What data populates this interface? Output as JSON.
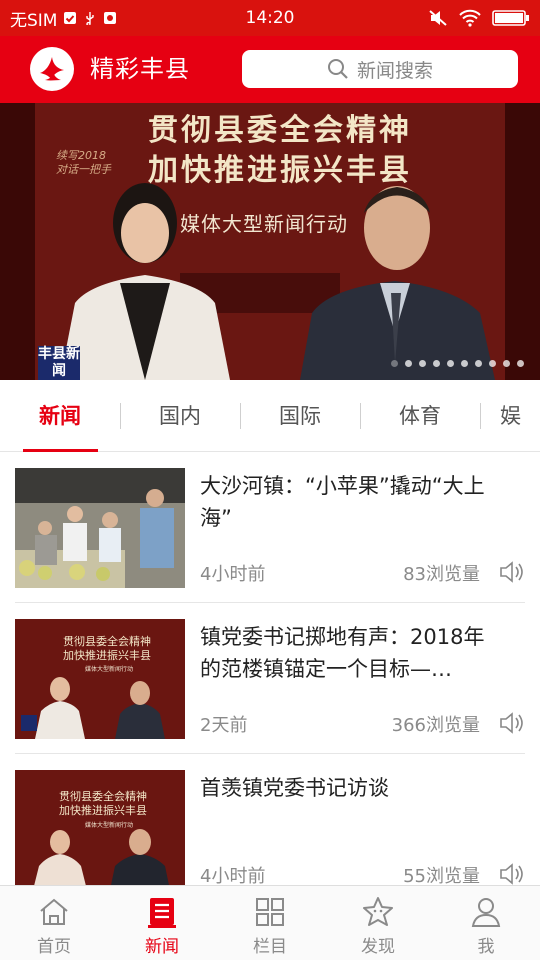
{
  "status_bar": {
    "carrier": "无SIM",
    "time": "14:20"
  },
  "header": {
    "app_name": "精彩丰县",
    "search_placeholder": "新闻搜索"
  },
  "banner": {
    "title_line1": "贯彻县委全会精神",
    "title_line2": "加快推进振兴丰县",
    "subtitle": "媒体大型新闻行动",
    "station_logo": "丰县新闻",
    "slide_count": 10,
    "active_slide": 0
  },
  "tabs": [
    {
      "label": "新闻",
      "active": true
    },
    {
      "label": "国内",
      "active": false
    },
    {
      "label": "国际",
      "active": false
    },
    {
      "label": "体育",
      "active": false
    },
    {
      "label": "娱",
      "active": false
    }
  ],
  "news": [
    {
      "title": "大沙河镇：“小苹果”撬动“大上海”",
      "time": "4小时前",
      "views": "83浏览量"
    },
    {
      "title": "镇党委书记掷地有声：2018年的范楼镇锚定一个目标—…",
      "time": "2天前",
      "views": "366浏览量"
    },
    {
      "title": "首羡镇党委书记访谈",
      "time": "4小时前",
      "views": "55浏览量"
    }
  ],
  "bottom_nav": [
    {
      "label": "首页",
      "icon": "home-icon",
      "active": false
    },
    {
      "label": "新闻",
      "icon": "news-icon",
      "active": true
    },
    {
      "label": "栏目",
      "icon": "grid-icon",
      "active": false
    },
    {
      "label": "发现",
      "icon": "star-icon",
      "active": false
    },
    {
      "label": "我",
      "icon": "person-icon",
      "active": false
    }
  ],
  "colors": {
    "brand_red": "#e60012",
    "status_red": "#d9120e"
  }
}
